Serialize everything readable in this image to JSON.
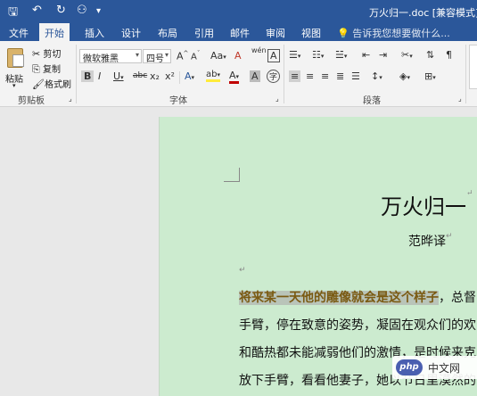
{
  "titlebar": {
    "title": "万火归一.doc [兼容模式] - W",
    "qa_save": "🖫",
    "qa_undo": "↶",
    "qa_redo": "↻",
    "qa_extra": "⚇",
    "qa_more": "▾"
  },
  "tabs": [
    "文件",
    "开始",
    "插入",
    "设计",
    "布局",
    "引用",
    "邮件",
    "审阅",
    "视图"
  ],
  "tell_me": "告诉我您想要做什么...",
  "ribbon": {
    "clipboard": {
      "paste": "粘贴",
      "cut": "剪切",
      "copy": "复制",
      "format_painter": "格式刷",
      "label": "剪贴板"
    },
    "font": {
      "font_name": "微软雅黑",
      "font_size": "四号",
      "grow": "A",
      "shrink": "A",
      "case": "Aa",
      "clear": "A",
      "phonetic": "wén",
      "border_char": "A",
      "bold": "B",
      "italic": "I",
      "underline": "U",
      "strike": "abc",
      "subscript": "x₂",
      "superscript": "x²",
      "effects": "A",
      "highlight": "ab",
      "font_color": "A",
      "shading": "A",
      "enclose": "字",
      "label": "字体"
    },
    "paragraph": {
      "label": "段落"
    }
  },
  "document": {
    "heading": "万火归一",
    "author": "范晔译",
    "lines": [
      {
        "selected": "将来某一天他的雕像就会是这个样子",
        "rest": "，总督"
      },
      {
        "selected": "",
        "rest": "手臂，停在致意的姿势，凝固在观众们的欢"
      },
      {
        "selected": "",
        "rest": "和酷热都未能减弱他们的激情，是时候来克"
      },
      {
        "selected": "",
        "rest": "放下手臂，看看他妻子，她以节日里漠然的"
      }
    ]
  },
  "watermark": {
    "logo": "php",
    "text": "中文网"
  },
  "colors": {
    "word_blue": "#2b579a",
    "page_green": "#ccebcf",
    "selection": "#b9c4b9"
  }
}
